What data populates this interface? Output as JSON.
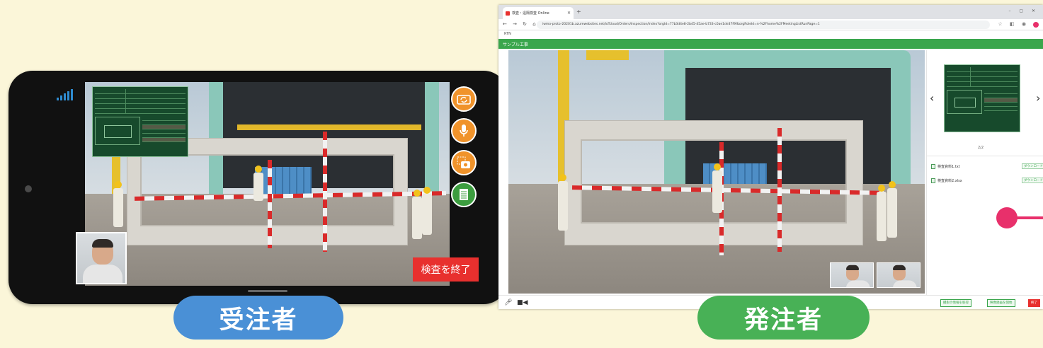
{
  "phone": {
    "end_button_label": "検査を終了",
    "side_buttons": [
      {
        "name": "camera-switch",
        "icon": "camera-switch-icon"
      },
      {
        "name": "microphone",
        "icon": "microphone-icon"
      },
      {
        "name": "photo-capture",
        "icon": "camera-capture-icon"
      },
      {
        "name": "document",
        "icon": "document-icon"
      }
    ]
  },
  "browser": {
    "tab_title": "検査・遠隔検査 Online",
    "url": "iwmo-proto-20201b.azurewebsites.net/IoTcloud/Orders/Inspection/Index?orgId=77b3d4e8-2b45-45ae-b733-c0ae1de37f9f&orgRoleId=n-%2Fhome%2FMeetingListRunPage=1",
    "bookmark": "RTN",
    "app_title": "サンプル工事",
    "pager": "2/2",
    "files": [
      {
        "name": "検査資料1.txt",
        "action": "ダウンロード"
      },
      {
        "name": "検査資料2.xlsx",
        "action": "ダウンロード"
      }
    ],
    "footer_buttons": [
      "撮影の情報を取得",
      "映像録画を開始",
      "終了"
    ]
  },
  "labels": {
    "contractor": "受注者",
    "client": "発注者"
  },
  "colors": {
    "background": "#fbf6d9",
    "accent_green": "#3aa64c",
    "accent_orange": "#f0932b",
    "accent_red": "#e8302e",
    "pill_blue": "#4a90d6",
    "pill_green": "#48b156"
  }
}
